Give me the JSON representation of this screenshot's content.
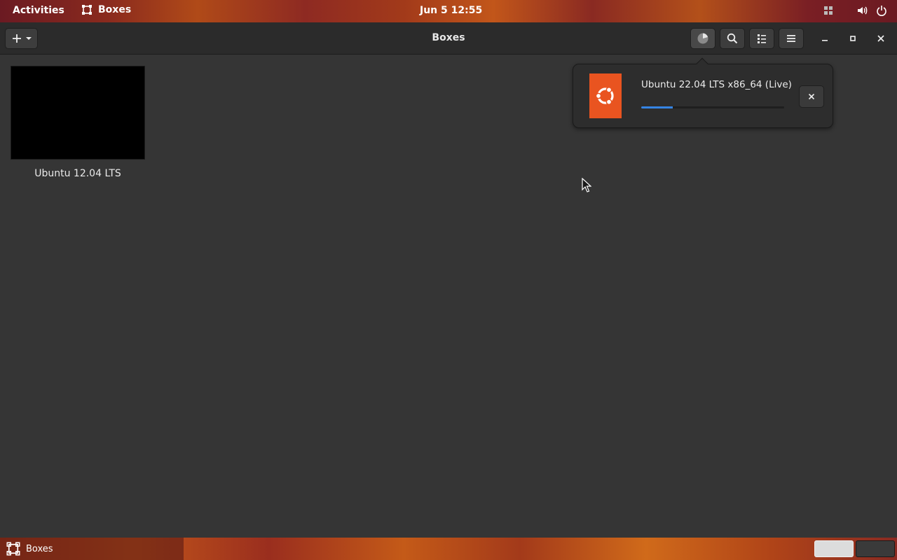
{
  "topbar": {
    "activities": "Activities",
    "app_name": "Boxes",
    "clock": "Jun 5  12:55"
  },
  "window": {
    "title": "Boxes"
  },
  "boxes": [
    {
      "label": "Ubuntu 12.04 LTS"
    }
  ],
  "downloads": {
    "items": [
      {
        "name": "Ubuntu 22.04 LTS x86_64 (Live)",
        "progress_fraction": 0.22
      }
    ]
  },
  "taskbar": {
    "task_label": "Boxes",
    "workspaces": [
      {
        "active": true
      },
      {
        "active": false
      }
    ]
  },
  "colors": {
    "accent": "#3584e4",
    "ubuntu_orange": "#e95420"
  }
}
